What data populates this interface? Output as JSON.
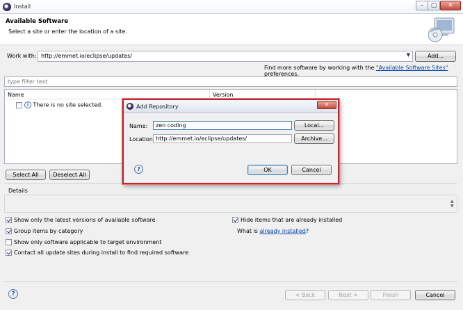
{
  "window": {
    "title": "Install",
    "min_glyph": "–",
    "max_glyph": "▢",
    "close_glyph": "✕"
  },
  "banner": {
    "title": "Available Software",
    "subtitle": "Select a site or enter the location of a site."
  },
  "work_with": {
    "label": "Work with:",
    "value": "http://emmet.io/eclipse/updates/",
    "add_label": "Add...",
    "find_more_prefix": "Find more software by working with the ",
    "find_more_link": "\"Available Software Sites\"",
    "find_more_suffix": " preferences."
  },
  "filter": {
    "placeholder": "type filter text"
  },
  "table": {
    "columns": [
      "Name",
      "Version"
    ],
    "rows": [
      {
        "text": "There is no site selected."
      }
    ]
  },
  "selection": {
    "select_all": "Select All",
    "deselect_all": "Deselect All"
  },
  "details": {
    "label": "Details"
  },
  "options": {
    "latest_versions": {
      "label": "Show only the latest versions of available software",
      "checked": true
    },
    "group_by_category": {
      "label": "Group items by category",
      "checked": true
    },
    "target_env": {
      "label": "Show only software applicable to target environment",
      "checked": false
    },
    "contact_sites": {
      "label": "Contact all update sites during install to find required software",
      "checked": true
    },
    "hide_installed": {
      "label": "Hide items that are already installed",
      "checked": true
    },
    "what_is_prefix": "What is ",
    "what_is_link": "already installed",
    "what_is_suffix": "?"
  },
  "footer": {
    "back": "< Back",
    "next": "Next >",
    "finish": "Finish",
    "cancel": "Cancel",
    "help_glyph": "?"
  },
  "modal": {
    "title": "Add Repository",
    "close_glyph": "✕",
    "name_label": "Name:",
    "name_value": "zen coding",
    "local_label": "Local...",
    "location_label": "Location:",
    "location_value": "http://emmet.io/eclipse/updates/",
    "archive_label": "Archive...",
    "ok_label": "OK",
    "cancel_label": "Cancel",
    "help_glyph": "?"
  }
}
